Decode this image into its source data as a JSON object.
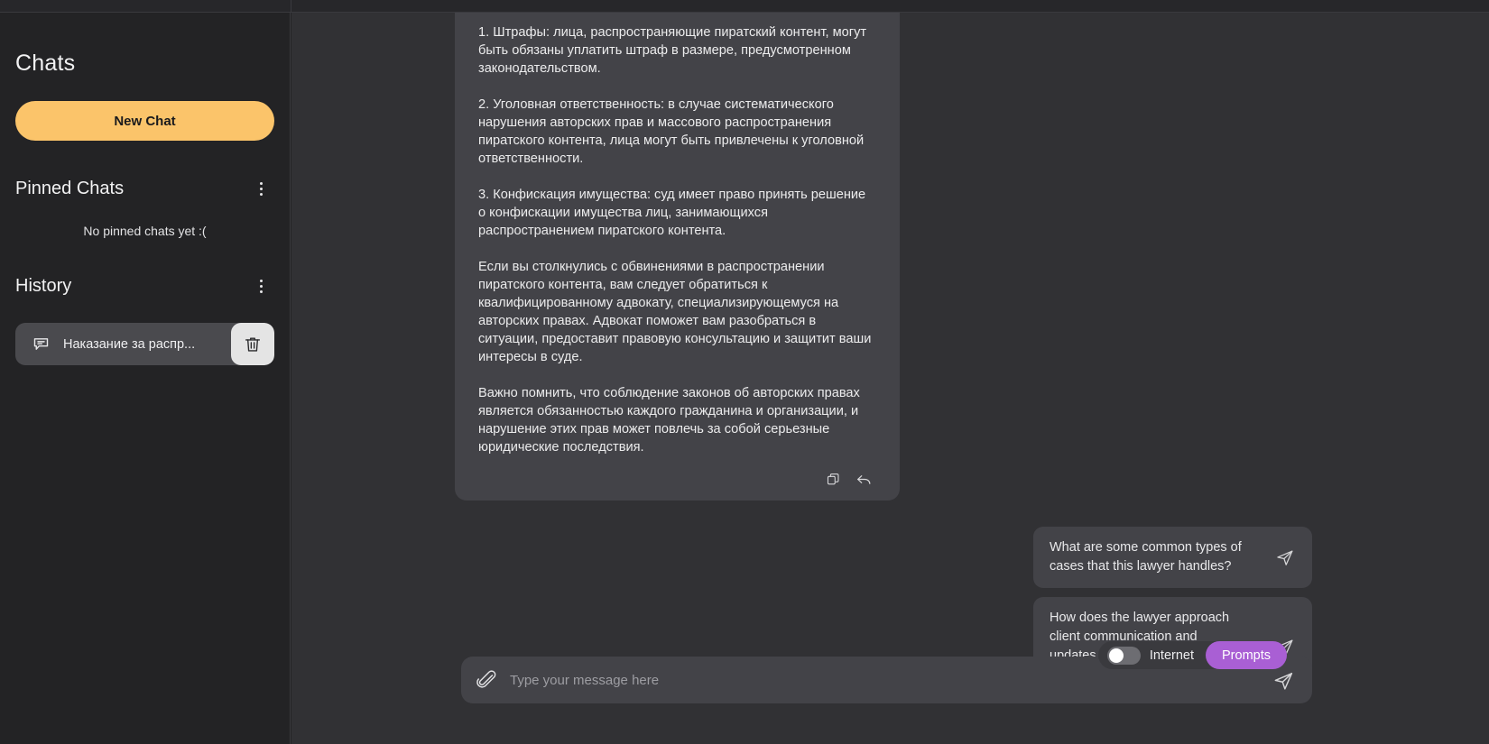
{
  "sidebar": {
    "title": "Chats",
    "new_chat_label": "New Chat",
    "pinned": {
      "heading": "Pinned Chats",
      "menu_icon": "kebab-menu-icon",
      "empty_text": "No pinned chats yet :("
    },
    "history": {
      "heading": "History",
      "menu_icon": "kebab-menu-icon",
      "items": [
        {
          "icon": "chat-bubble-icon",
          "label": "Наказание за распр...",
          "delete_icon": "trash-icon"
        }
      ]
    }
  },
  "conversation": {
    "assistant_message": {
      "paragraphs": [
        "1. Штрафы: лица, распространяющие пиратский контент, могут быть обязаны уплатить штраф в размере, предусмотренном законодательством.",
        "2. Уголовная ответственность: в случае систематического нарушения авторских прав и массового распространения пиратского контента, лица могут быть привлечены к уголовной ответственности.",
        "3. Конфискация имущества: суд имеет право принять решение о конфискации имущества лиц, занимающихся распространением пиратского контента.",
        "Если вы столкнулись с обвинениями в распространении пиратского контента, вам следует обратиться к квалифицированному адвокату, специализирующемуся на авторских правах. Адвокат поможет вам разобраться в ситуации, предоставит правовую консультацию и защитит ваши интересы в суде.",
        "Важно помнить, что соблюдение законов об авторских правах является обязанностью каждого гражданина и организации, и нарушение этих прав может повлечь за собой серьезные юридические последствия."
      ],
      "actions": [
        {
          "icon": "copy-icon",
          "name": "copy-message-button"
        },
        {
          "icon": "reply-icon",
          "name": "reply-message-button"
        }
      ]
    }
  },
  "suggestions": [
    {
      "text": "What are some common types of cases that this lawyer handles?",
      "send_icon": "send-icon"
    },
    {
      "text": "How does the lawyer approach client communication and updates during the legal process?",
      "send_icon": "send-icon"
    }
  ],
  "controls": {
    "internet_toggle": {
      "label": "Internet",
      "enabled": false
    },
    "prompts_label": "Prompts"
  },
  "composer": {
    "attach_icon": "paperclip-icon",
    "placeholder": "Type your message here",
    "value": "",
    "send_icon": "send-icon"
  },
  "colors": {
    "accent_orange": "#fbc46a",
    "accent_purple": "#a95fd4",
    "bubble_bg": "#434348",
    "main_bg": "#313134",
    "sidebar_bg": "#232325"
  }
}
